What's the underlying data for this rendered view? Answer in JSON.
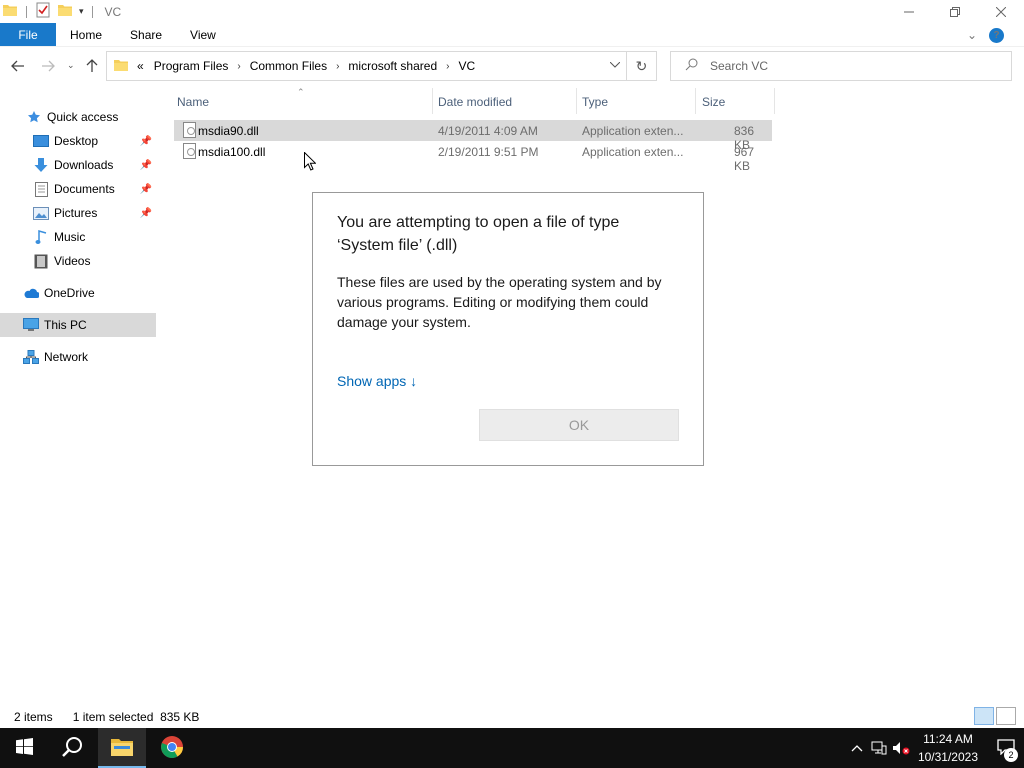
{
  "window": {
    "title": "VC"
  },
  "ribbon": {
    "tabs": [
      {
        "label": "File"
      },
      {
        "label": "Home"
      },
      {
        "label": "Share"
      },
      {
        "label": "View"
      }
    ]
  },
  "address": {
    "breadcrumbs": [
      {
        "label": "Program Files"
      },
      {
        "label": "Common Files"
      },
      {
        "label": "microsoft shared"
      },
      {
        "label": "VC"
      }
    ],
    "search_placeholder": "Search VC"
  },
  "nav": {
    "quick_access": "Quick access",
    "items": [
      {
        "label": "Desktop"
      },
      {
        "label": "Downloads"
      },
      {
        "label": "Documents"
      },
      {
        "label": "Pictures"
      },
      {
        "label": "Music"
      },
      {
        "label": "Videos"
      }
    ],
    "onedrive": "OneDrive",
    "this_pc": "This PC",
    "network": "Network"
  },
  "columns": {
    "name": "Name",
    "date": "Date modified",
    "type": "Type",
    "size": "Size"
  },
  "files": [
    {
      "name": "msdia90.dll",
      "date": "4/19/2011 4:09 AM",
      "type": "Application exten...",
      "size": "836 KB",
      "selected": true
    },
    {
      "name": "msdia100.dll",
      "date": "2/19/2011 9:51 PM",
      "type": "Application exten...",
      "size": "967 KB",
      "selected": false
    }
  ],
  "dialog": {
    "title": "You are attempting to open a file of type ‘System file’ (.dll)",
    "body": "These files are used by the operating system and by various programs. Editing or modifying them could damage your system.",
    "link": "Show apps ↓",
    "ok": "OK"
  },
  "status": {
    "items": "2 items",
    "selected": "1 item selected  835 KB"
  },
  "taskbar": {
    "time": "11:24 AM",
    "date": "10/31/2023",
    "notifications": "2"
  },
  "colors": {
    "accent": "#1979ca",
    "link": "#0066b4",
    "selection": "#d9d9d9",
    "taskbar": "#101010"
  }
}
